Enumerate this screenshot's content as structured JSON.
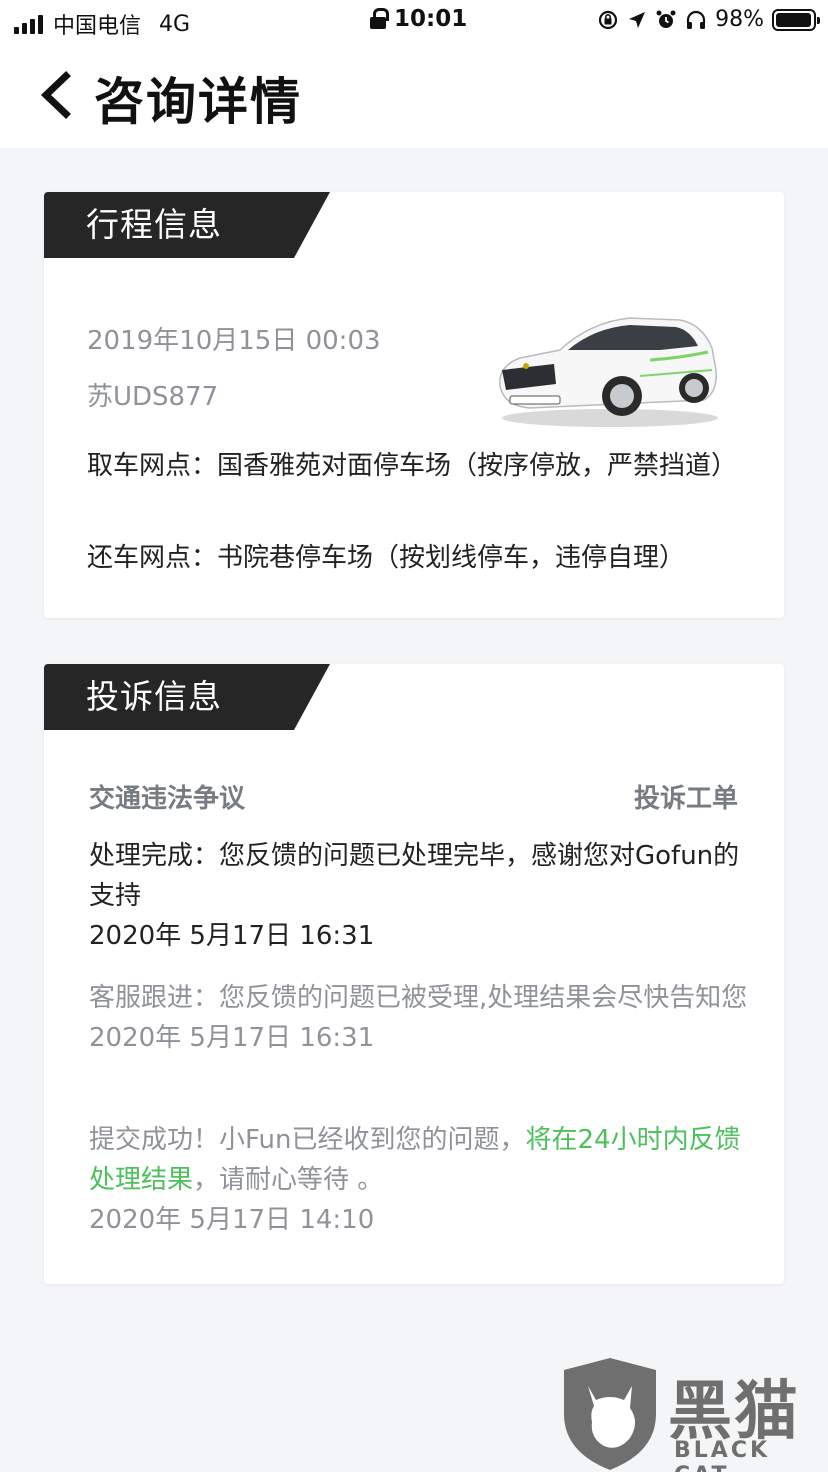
{
  "status_bar": {
    "carrier": "中国电信",
    "network": "4G",
    "time": "10:01",
    "battery": "98%",
    "battery_level": 0.98
  },
  "header": {
    "title": "咨询详情",
    "back_icon": "chevron-left-icon"
  },
  "trip_card": {
    "tab_label": "行程信息",
    "datetime": "2019年10月15日 00:03",
    "plate": "苏UDS877",
    "pickup": "取车网点：国香雅苑对面停车场（按序停放，严禁挡道）",
    "return": "还车网点：书院巷停车场（按划线停车，违停自理）"
  },
  "complaint_card": {
    "tab_label": "投诉信息",
    "topic": "交通违法争议",
    "ticket_link": "投诉工单",
    "entries": [
      {
        "text": "处理完成：您反馈的问题已处理完毕，感谢您对Gofun的支持",
        "time": "2020年 5月17日 16:31"
      },
      {
        "text": "客服跟进：您反馈的问题已被受理,处理结果会尽快告知您",
        "time": "2020年 5月17日 16:31"
      },
      {
        "text_before": "提交成功！小Fun已经收到您的问题，",
        "text_highlight": "将在24小时内反馈处理结果",
        "text_after": "，请耐心等待 。",
        "time": "2020年 5月17日 14:10"
      }
    ]
  },
  "watermark": {
    "text": "黑猫",
    "sub": "BLACK CAT"
  },
  "colors": {
    "tab_bg": "#262626",
    "highlight": "#4cc05a",
    "muted_text": "#8f9399",
    "page_bg": "#f4f5f7"
  }
}
